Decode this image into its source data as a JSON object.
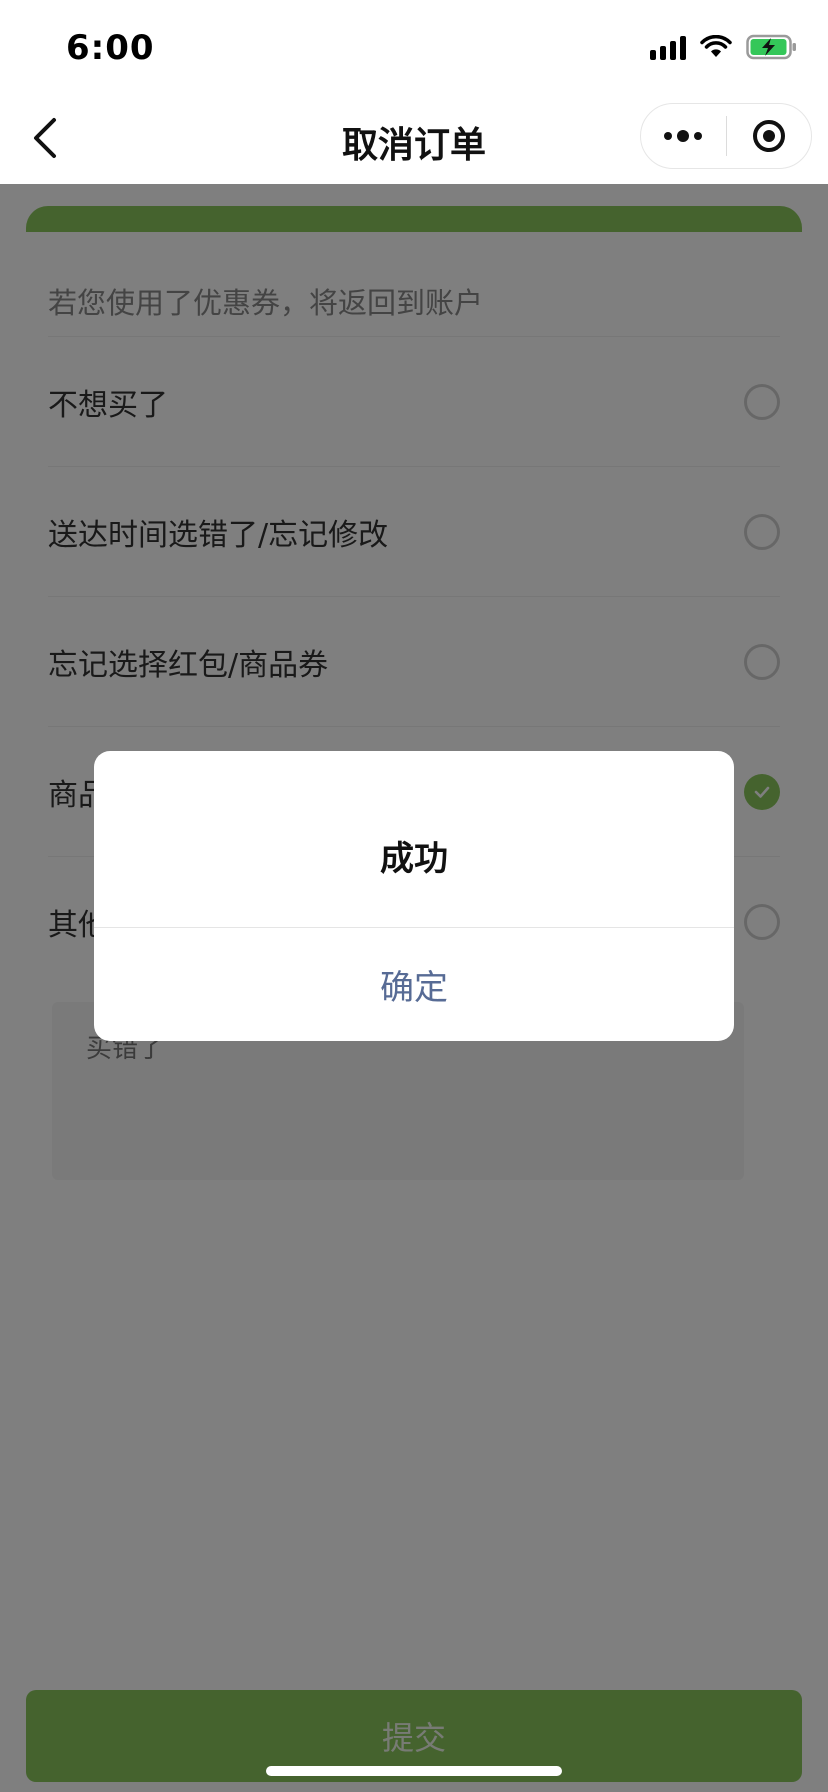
{
  "status_bar": {
    "time": "6:00"
  },
  "nav": {
    "title": "取消订单"
  },
  "form": {
    "notice": "若您使用了优惠券，将返回到账户",
    "reasons": [
      {
        "label": "不想买了",
        "checked": false
      },
      {
        "label": "送达时间选错了/忘记修改",
        "checked": false
      },
      {
        "label": "忘记选择红包/商品券",
        "checked": false
      },
      {
        "label": "商品",
        "checked": true
      },
      {
        "label": "其他",
        "checked": false
      }
    ],
    "textarea_value": "买错了",
    "submit_label": "提交"
  },
  "dialog": {
    "title": "成功",
    "confirm_label": "确定"
  },
  "colors": {
    "accent": "#8ac75d",
    "dialog_link": "#576b95"
  }
}
